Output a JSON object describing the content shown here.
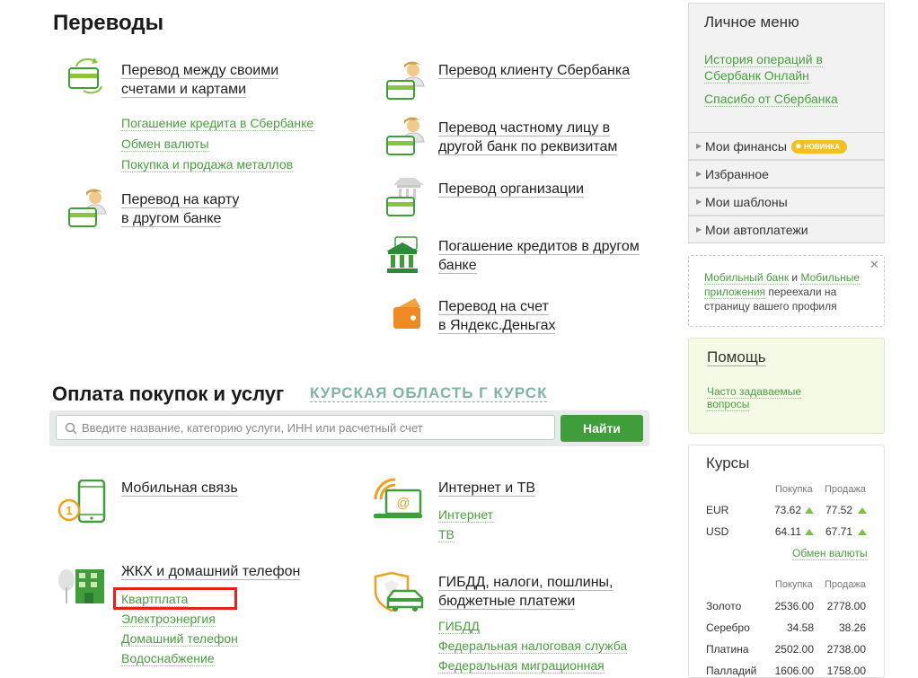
{
  "transfers": {
    "heading": "Переводы",
    "own_accounts": {
      "line1": "Перевод между своими",
      "line2": "счетами и картами"
    },
    "sublinks": [
      "Погашение кредита в Сбербанке",
      "Обмен валюты",
      "Покупка и продажа металлов"
    ],
    "card_other_bank": {
      "line1": "Перевод на карту",
      "line2": "в другом банке"
    },
    "sber_client": {
      "line1": "Перевод клиенту Сбербанка"
    },
    "private_person": {
      "line1": "Перевод частному лицу в",
      "line2": "другой банк по реквизитам"
    },
    "organization": {
      "line1": "Перевод организации"
    },
    "loan_other_bank": {
      "line1": "Погашение кредитов в другом",
      "line2": "банке"
    },
    "yandex": {
      "line1": "Перевод на счет",
      "line2": "в Яндекс.Деньгах"
    }
  },
  "payments": {
    "heading": "Оплата покупок и услуг",
    "region": "КУРСКАЯ ОБЛАСТЬ Г КУРСК",
    "search": {
      "placeholder": "Введите название, категорию услуги, ИНН или расчетный счет",
      "button": "Найти"
    },
    "mobile": {
      "title": "Мобильная связь"
    },
    "internet_tv": {
      "title": "Интернет и ТВ",
      "links": [
        "Интернет",
        "ТВ"
      ]
    },
    "housing": {
      "title": "ЖКХ и домашний телефон",
      "links": [
        "Квартплата",
        "Электроэнергия",
        "Домашний телефон",
        "Водоснабжение"
      ]
    },
    "gibdd": {
      "line1": "ГИБДД, налоги, пошлины,",
      "line2": "бюджетные платежи",
      "links": [
        "ГИБДД",
        "Федеральная налоговая служба",
        "Федеральная миграционная"
      ]
    }
  },
  "personal_menu": {
    "title": "Личное меню",
    "history": {
      "line1": "История операций в",
      "line2": "Сбербанк Онлайн"
    },
    "spasibo": "Спасибо от Сбербанка",
    "items": [
      "Мои финансы",
      "Избранное",
      "Мои шаблоны",
      "Мои автоплатежи"
    ],
    "badge": "НОВИНКА"
  },
  "notice": {
    "link1": "Мобильный банк",
    "mid1": " и ",
    "link2a": "Мобильные",
    "link2b": "приложения",
    "rest1": " переехали на",
    "rest2": "страницу вашего профиля"
  },
  "help": {
    "title": "Помощь",
    "faq_line1": "Часто задаваемые",
    "faq_line2": "вопросы"
  },
  "rates": {
    "title": "Курсы",
    "col_buy": "Покупка",
    "col_sell": "Продажа",
    "currencies": [
      {
        "name": "EUR",
        "buy": "73.62",
        "sell": "77.52"
      },
      {
        "name": "USD",
        "buy": "64.11",
        "sell": "67.71"
      }
    ],
    "exchange_link": "Обмен валюты",
    "metals": [
      {
        "name": "Золото",
        "buy": "2536.00",
        "sell": "2778.00"
      },
      {
        "name": "Серебро",
        "buy": "34.58",
        "sell": "38.26"
      },
      {
        "name": "Платина",
        "buy": "2502.00",
        "sell": "2738.00"
      },
      {
        "name": "Палладий",
        "buy": "1606.00",
        "sell": "1758.00"
      }
    ]
  },
  "colors": {
    "accent": "#3f9e3a",
    "link": "#4a9e3f",
    "highlight": "#e1231b",
    "badge": "#f4c021"
  }
}
